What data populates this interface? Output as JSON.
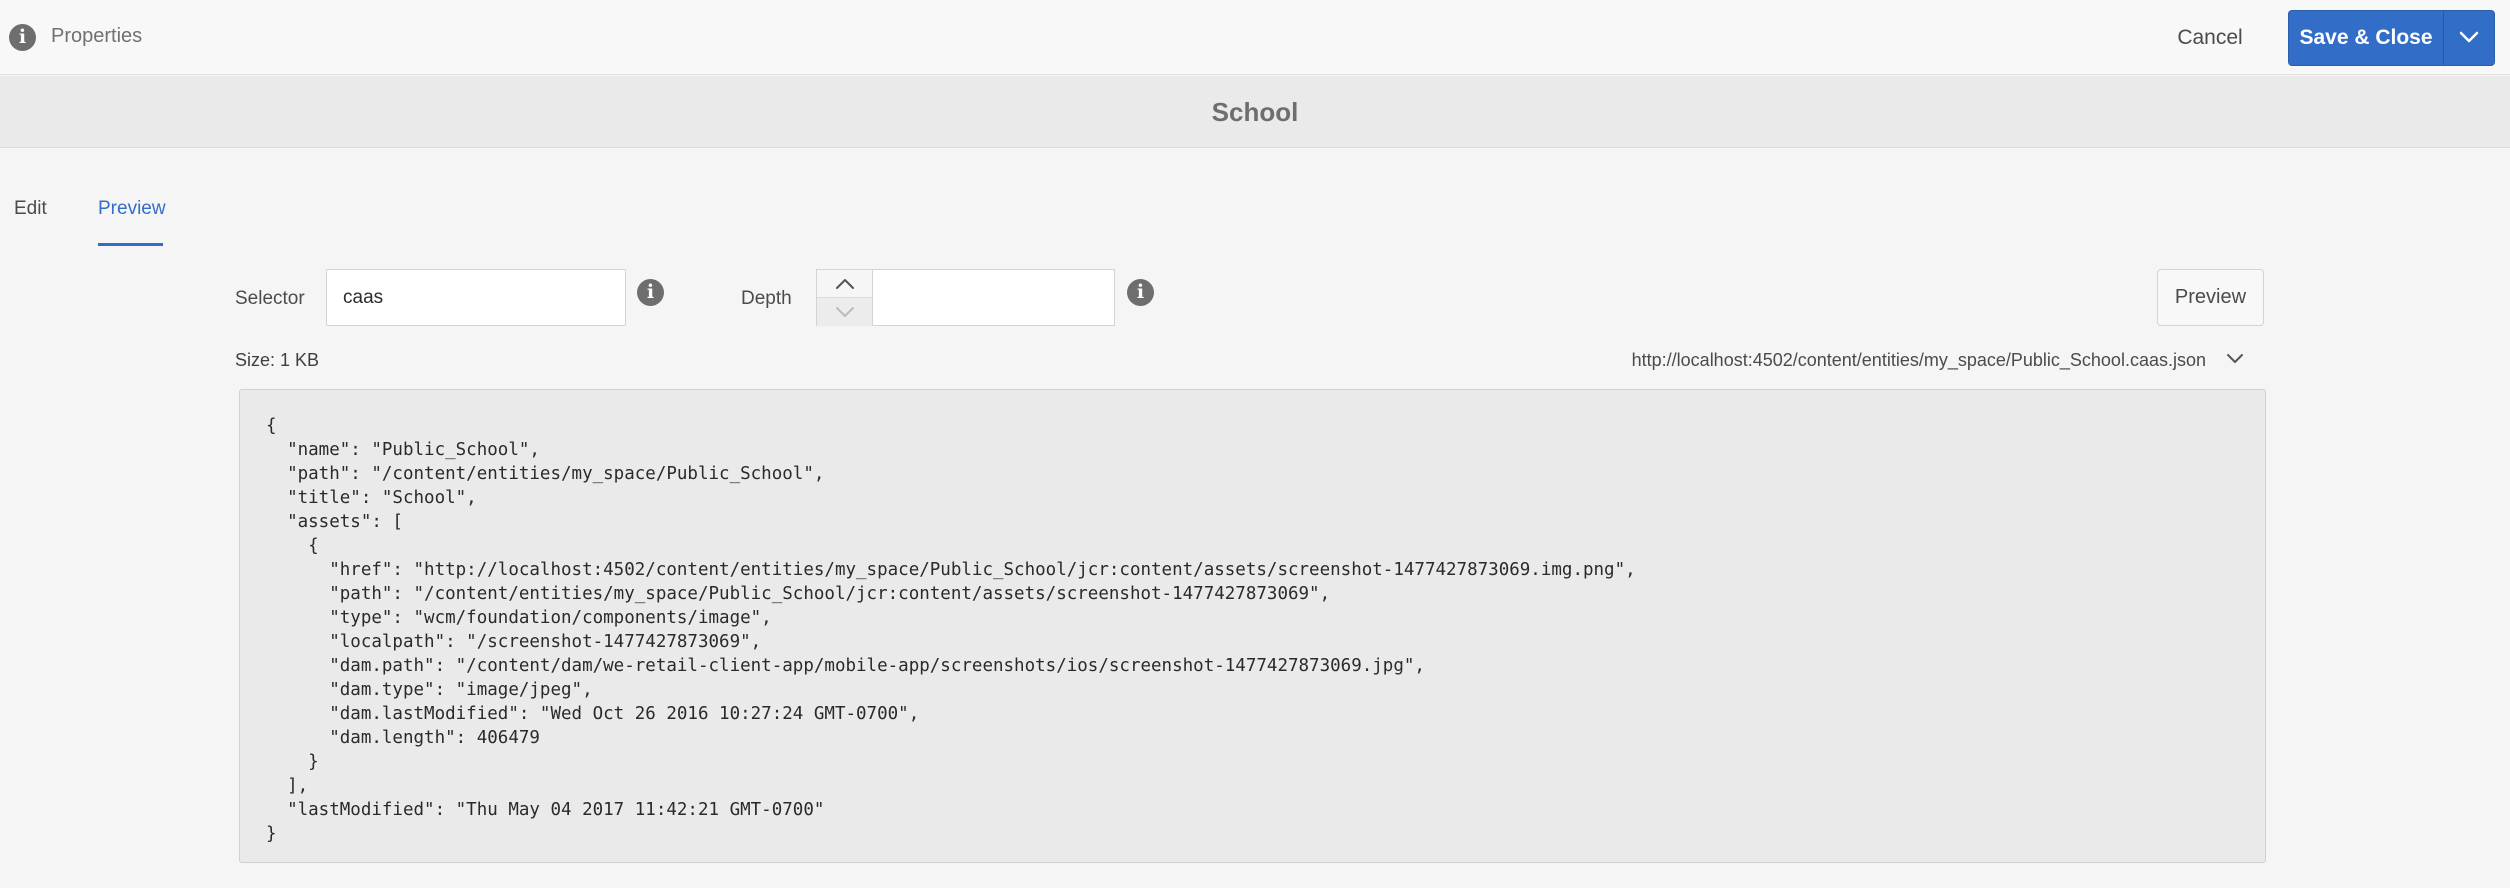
{
  "toolbar": {
    "title": "Properties",
    "cancel_label": "Cancel",
    "save_label": "Save & Close"
  },
  "page": {
    "title": "School"
  },
  "tabs": [
    {
      "label": "Edit",
      "active": false
    },
    {
      "label": "Preview",
      "active": true
    }
  ],
  "form": {
    "selector_label": "Selector",
    "selector_value": "caas",
    "depth_label": "Depth",
    "depth_value": "",
    "preview_label": "Preview"
  },
  "output": {
    "size": "Size: 1 KB",
    "url": "http://localhost:4502/content/entities/my_space/Public_School.caas.json",
    "json": "{\n  \"name\": \"Public_School\",\n  \"path\": \"/content/entities/my_space/Public_School\",\n  \"title\": \"School\",\n  \"assets\": [\n    {\n      \"href\": \"http://localhost:4502/content/entities/my_space/Public_School/jcr:content/assets/screenshot-1477427873069.img.png\",\n      \"path\": \"/content/entities/my_space/Public_School/jcr:content/assets/screenshot-1477427873069\",\n      \"type\": \"wcm/foundation/components/image\",\n      \"localpath\": \"/screenshot-1477427873069\",\n      \"dam.path\": \"/content/dam/we-retail-client-app/mobile-app/screenshots/ios/screenshot-1477427873069.jpg\",\n      \"dam.type\": \"image/jpeg\",\n      \"dam.lastModified\": \"Wed Oct 26 2016 10:27:24 GMT-0700\",\n      \"dam.length\": 406479\n    }\n  ],\n  \"lastModified\": \"Thu May 04 2017 11:42:21 GMT-0700\"\n}"
  },
  "colors": {
    "accent": "#326ec8",
    "background": "#f5f5f5",
    "json_background": "#eaeaea"
  },
  "icons": {
    "info": "info-icon",
    "save_dropdown": "chevron-down-icon",
    "stepper_up": "chevron-up-icon",
    "stepper_down": "chevron-down-icon",
    "url_dropdown": "chevron-down-icon"
  }
}
